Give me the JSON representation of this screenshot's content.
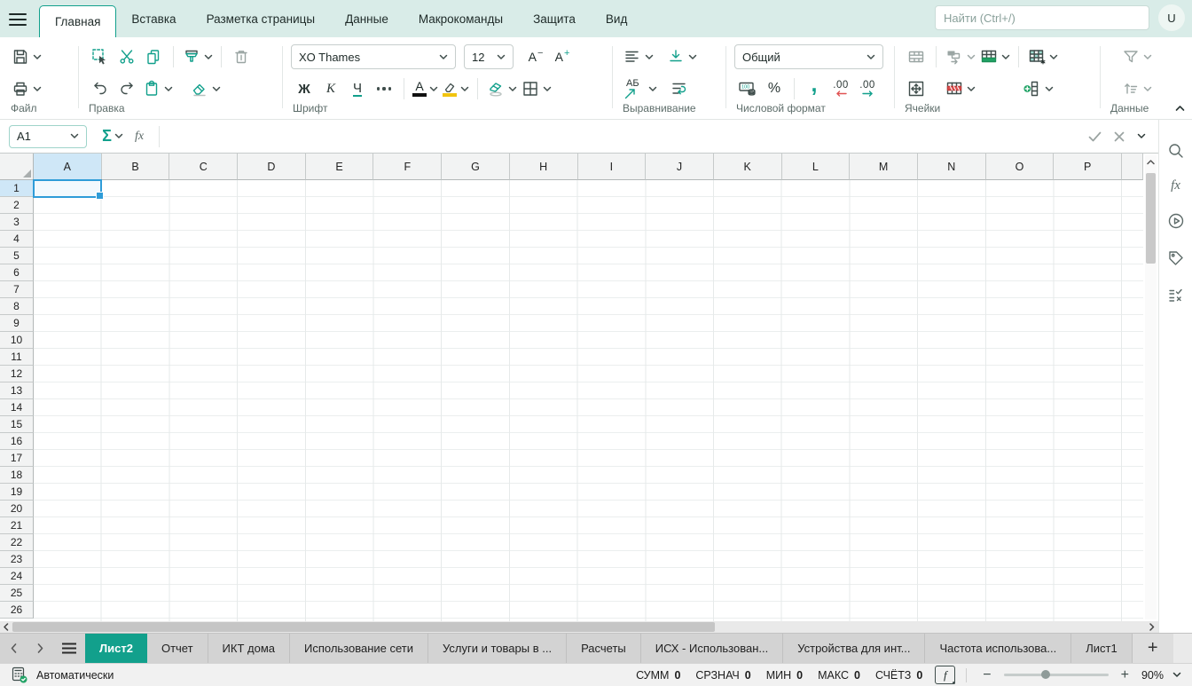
{
  "colors": {
    "accent": "#12a08c",
    "topbar_bg": "#d9ece8",
    "selection": "#2f9cd8",
    "insert_green": "#21a366",
    "delete_red": "#e05252",
    "highlight_yellow": "#f1c40f",
    "header_selected": "#cfe7f7",
    "active_sheet_tab": "#12a08c"
  },
  "menu": {
    "tabs": [
      {
        "label": "Главная",
        "active": true
      },
      {
        "label": "Вставка",
        "active": false
      },
      {
        "label": "Разметка страницы",
        "active": false
      },
      {
        "label": "Данные",
        "active": false
      },
      {
        "label": "Макрокоманды",
        "active": false
      },
      {
        "label": "Защита",
        "active": false
      },
      {
        "label": "Вид",
        "active": false
      }
    ],
    "search_placeholder": "Найти (Ctrl+/)",
    "avatar_initial": "U"
  },
  "toolbar": {
    "groups": {
      "file": "Файл",
      "edit": "Правка",
      "font": "Шрифт",
      "align": "Выравнивание",
      "number": "Числовой формат",
      "cells": "Ячейки",
      "data": "Данные"
    },
    "font": {
      "family": "XO Thames",
      "size": "12",
      "bold": "Ж",
      "italic": "К",
      "underline": "Ч",
      "color_letter": "А",
      "size_letter": "A",
      "decrease_sign": "−",
      "increase_sign": "+"
    },
    "number": {
      "format": "Общий",
      "percent": "%",
      "comma": ",",
      "dec": ".00",
      "currency_icon_text": "100"
    },
    "align": {
      "rotate_text": "АБ"
    }
  },
  "formula_bar": {
    "cell_ref": "A1",
    "sigma": "Σ",
    "fx": "fx",
    "formula": ""
  },
  "grid": {
    "columns": [
      "A",
      "B",
      "C",
      "D",
      "E",
      "F",
      "G",
      "H",
      "I",
      "J",
      "K",
      "L",
      "M",
      "N",
      "O",
      "P"
    ],
    "rows": [
      1,
      2,
      3,
      4,
      5,
      6,
      7,
      8,
      9,
      10,
      11,
      12,
      13,
      14,
      15,
      16,
      17,
      18,
      19,
      20,
      21,
      22,
      23,
      24,
      25,
      26
    ],
    "selected_cell": "A1",
    "selected_column": "A",
    "selected_row": 1
  },
  "sidebar": {
    "fx": "fx"
  },
  "sheet_bar": {
    "tabs": [
      {
        "label": "Лист2",
        "active": true
      },
      {
        "label": "Отчет",
        "active": false
      },
      {
        "label": "ИКТ дома",
        "active": false
      },
      {
        "label": "Использование сети",
        "active": false
      },
      {
        "label": "Услуги и товары в ...",
        "active": false
      },
      {
        "label": "Расчеты",
        "active": false
      },
      {
        "label": "ИСХ - Использован...",
        "active": false
      },
      {
        "label": "Устройства для инт...",
        "active": false
      },
      {
        "label": "Частота использова...",
        "active": false
      },
      {
        "label": "Лист1",
        "active": false
      }
    ],
    "add_label": "+"
  },
  "status_bar": {
    "calc_mode": "Автоматически",
    "stats": [
      {
        "label": "СУММ",
        "value": "0"
      },
      {
        "label": "СРЗНАЧ",
        "value": "0"
      },
      {
        "label": "МИН",
        "value": "0"
      },
      {
        "label": "МАКС",
        "value": "0"
      },
      {
        "label": "СЧЁТЗ",
        "value": "0"
      }
    ],
    "fbox": "f",
    "zoom": "90%"
  }
}
